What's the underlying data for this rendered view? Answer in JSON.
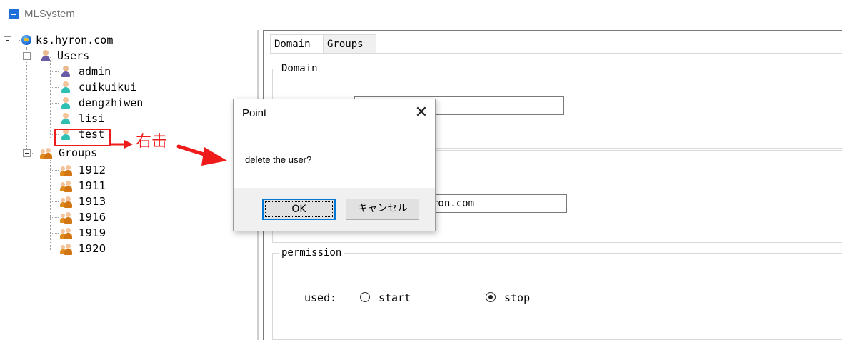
{
  "window": {
    "title": "MLSystem",
    "icon": "app-window-icon"
  },
  "tree": {
    "root": {
      "label": "ks.hyron.com",
      "icon": "globe-icon"
    },
    "users": {
      "label": "Users",
      "icon": "users-folder-icon",
      "items": [
        {
          "label": "admin",
          "icon": "admin-user-icon"
        },
        {
          "label": "cuikuikui",
          "icon": "user-icon"
        },
        {
          "label": "dengzhiwen",
          "icon": "user-icon"
        },
        {
          "label": "lisi",
          "icon": "user-icon"
        },
        {
          "label": "test",
          "icon": "user-icon"
        }
      ]
    },
    "groups": {
      "label": "Groups",
      "icon": "group-icon",
      "items": [
        {
          "label": "1912"
        },
        {
          "label": "1911"
        },
        {
          "label": "1913"
        },
        {
          "label": "1916"
        },
        {
          "label": "1919"
        },
        {
          "label": "1920"
        }
      ]
    }
  },
  "annotation": {
    "text": "右击",
    "color": "#ef1b1b"
  },
  "tabs": [
    {
      "label": "Domain",
      "active": true
    },
    {
      "label": "Groups",
      "active": false
    }
  ],
  "panel": {
    "domain_group": {
      "legend": "Domain"
    },
    "field1": {
      "value": ""
    },
    "field2": {
      "value": "ron.com"
    },
    "permission_group": {
      "legend": "permission",
      "used_label": "used:",
      "options": [
        {
          "label": "start",
          "checked": false
        },
        {
          "label": "stop",
          "checked": true
        }
      ]
    }
  },
  "dialog": {
    "title": "Point",
    "close_glyph": "✕",
    "message": "delete the user?",
    "ok_label": "OK",
    "cancel_label": "キャンセル"
  }
}
